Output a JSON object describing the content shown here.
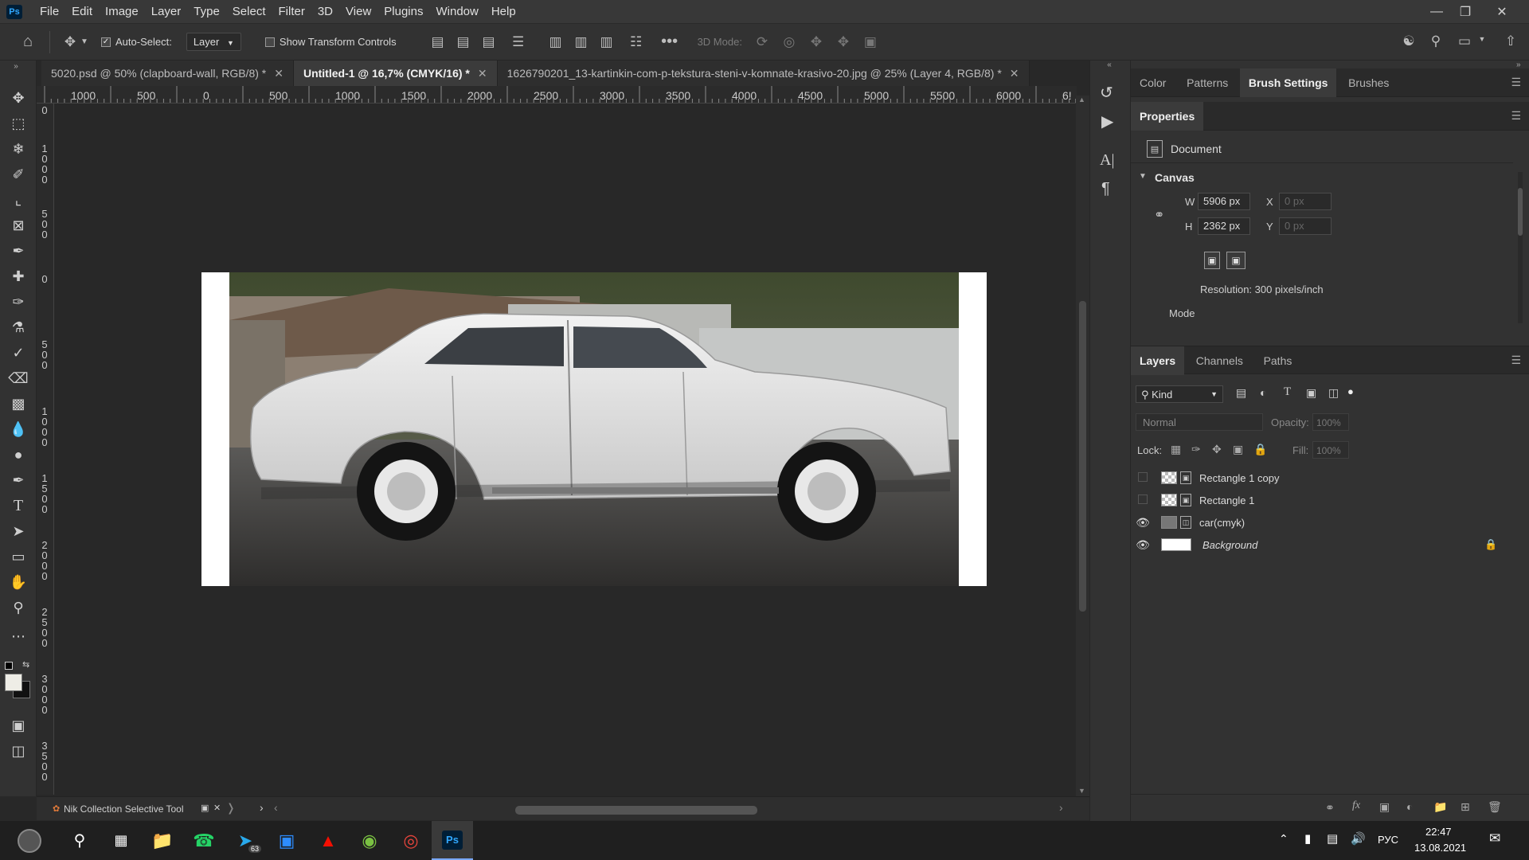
{
  "menubar": {
    "logo": "Ps",
    "items": [
      "File",
      "Edit",
      "Image",
      "Layer",
      "Type",
      "Select",
      "Filter",
      "3D",
      "View",
      "Plugins",
      "Window",
      "Help"
    ]
  },
  "options": {
    "auto_select_label": "Auto-Select:",
    "auto_select_target": "Layer",
    "show_transform_label": "Show Transform Controls",
    "three_d_mode_label": "3D Mode:"
  },
  "tabs": [
    {
      "label": "5020.psd @ 50% (clapboard-wall, RGB/8) *"
    },
    {
      "label": "Untitled-1 @ 16,7% (CMYK/16) *"
    },
    {
      "label": "1626790201_13-kartinkin-com-p-tekstura-steni-v-komnate-krasivo-20.jpg @ 25% (Layer 4, RGB/8) *"
    }
  ],
  "ruler": {
    "h_ticks": [
      "1000",
      "500",
      "0",
      "500",
      "1000",
      "1500",
      "2000",
      "2500",
      "3000",
      "3500",
      "4000",
      "4500",
      "5000",
      "5500",
      "6000",
      "6!"
    ],
    "v_ticks": [
      "0",
      "1 0 0 0",
      "5 0 0",
      "0",
      "5 0 0",
      "1 0 0 0",
      "1 5 0 0",
      "2 0 0 0",
      "2 5 0 0",
      "3 0 0 0",
      "3 5 0 0"
    ]
  },
  "panels": {
    "top_tabs": [
      "Color",
      "Patterns",
      "Brush Settings",
      "Brushes"
    ],
    "properties_title": "Properties",
    "document_label": "Document",
    "canvas_label": "Canvas",
    "width_label": "W",
    "width_value": "5906 px",
    "height_label": "H",
    "height_value": "2362 px",
    "x_label": "X",
    "x_value": "0 px",
    "y_label": "Y",
    "y_value": "0 px",
    "resolution": "Resolution: 300 pixels/inch",
    "mode_label": "Mode"
  },
  "layers": {
    "tabs": [
      "Layers",
      "Channels",
      "Paths"
    ],
    "kind_label": "Kind",
    "blend_mode": "Normal",
    "opacity_label": "Opacity:",
    "opacity_value": "100%",
    "lock_label": "Lock:",
    "fill_label": "Fill:",
    "fill_value": "100%",
    "items": [
      {
        "name": "Rectangle 1 copy",
        "visible": false
      },
      {
        "name": "Rectangle 1",
        "visible": false
      },
      {
        "name": "car(cmyk)",
        "visible": true
      },
      {
        "name": "Background",
        "visible": true
      }
    ]
  },
  "status": {
    "plugin": "Nik Collection Selective Tool"
  },
  "taskbar": {
    "lang": "РУС",
    "time": "22:47",
    "date": "13.08.2021",
    "telegram_badge": "63"
  }
}
